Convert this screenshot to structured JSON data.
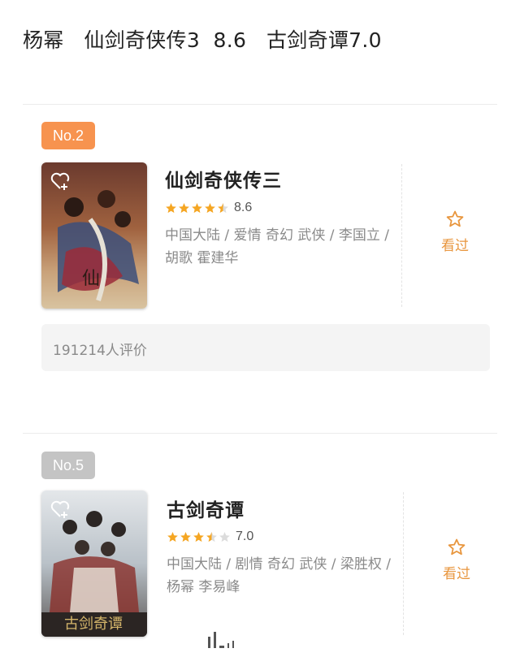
{
  "header": {
    "title": "杨幂   仙剑奇侠传3  8.6   古剑奇谭7.0"
  },
  "movies": [
    {
      "rank": "No.2",
      "title": "仙剑奇侠传三",
      "stars": [
        1,
        1,
        1,
        1,
        0.5
      ],
      "score": "8.6",
      "meta": "中国大陆 / 爱情 奇幻 武侠 / 李国立 / 胡歌 霍建华",
      "watched_label": "看过",
      "reviews": "191214人评价",
      "rank_color": "#f7934f",
      "poster_icon": "add-to-list-icon"
    },
    {
      "rank": "No.5",
      "title": "古剑奇谭",
      "stars": [
        1,
        1,
        1,
        0.5,
        0
      ],
      "score": "7.0",
      "meta": "中国大陆 / 剧情 奇幻 武侠 / 梁胜权 / 杨幂 李易峰",
      "watched_label": "看过",
      "rank_color": "#c4c4c4",
      "poster_icon": "add-to-list-icon"
    }
  ],
  "colors": {
    "star_filled": "#f5a623",
    "star_empty": "#dcdcdc",
    "accent": "#e8963e"
  }
}
